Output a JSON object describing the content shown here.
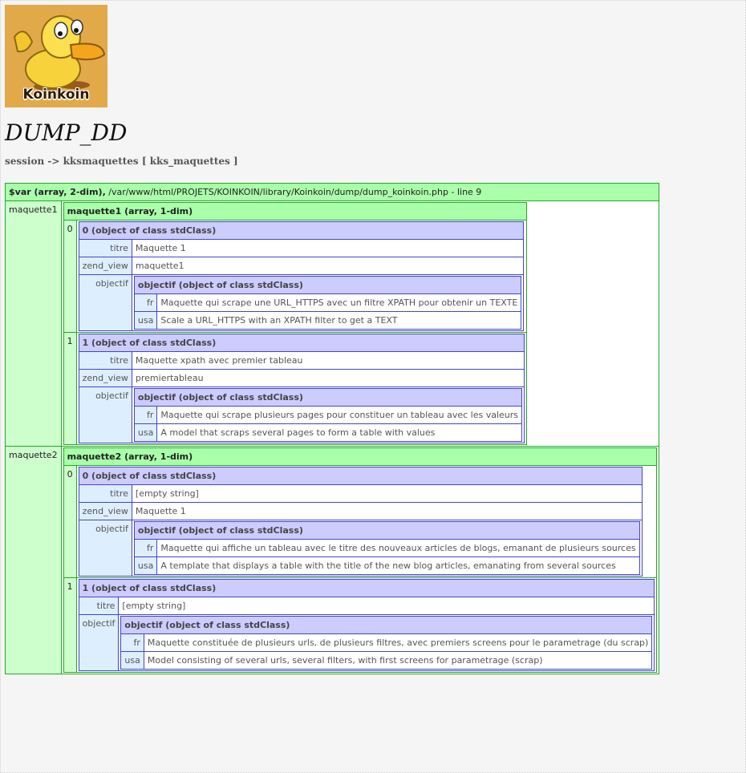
{
  "logo": {
    "text": "Koinkoin",
    "icon": "duck-mascot-icon"
  },
  "title": "DUMP_DD",
  "breadcrumb": "session -> kksmaquettes [ kks_maquettes ]",
  "dump": {
    "var_name": "$var (array, 2-dim),",
    "location": " /var/www/html/PROJETS/KOINKOIN/library/Koinkoin/dump/dump_koinkoin.php - line 9",
    "maquette1": {
      "key": "maquette1",
      "header": "maquette1 (array, 1-dim)",
      "items": [
        {
          "index": "0",
          "header": "0 (object of class stdClass)",
          "titre_key": "titre",
          "titre": "Maquette 1",
          "zend_key": "zend_view",
          "zend_view": "maquette1",
          "objectif_key": "objectif",
          "objectif_header": "objectif (object of class stdClass)",
          "fr_key": "fr",
          "fr": "Maquette qui scrape une URL_HTTPS avec un filtre XPATH pour obtenir un TEXTE",
          "usa_key": "usa",
          "usa": "Scale a URL_HTTPS with an XPATH filter to get a TEXT"
        },
        {
          "index": "1",
          "header": "1 (object of class stdClass)",
          "titre_key": "titre",
          "titre": "Maquette xpath avec premier tableau",
          "zend_key": "zend_view",
          "zend_view": "premiertableau",
          "objectif_key": "objectif",
          "objectif_header": "objectif (object of class stdClass)",
          "fr_key": "fr",
          "fr": "Maquette qui scrape plusieurs pages pour constituer un tableau avec les valeurs",
          "usa_key": "usa",
          "usa": "A model that scraps several pages to form a table with values"
        }
      ]
    },
    "maquette2": {
      "key": "maquette2",
      "header": "maquette2 (array, 1-dim)",
      "items": [
        {
          "index": "0",
          "header": "0 (object of class stdClass)",
          "titre_key": "titre",
          "titre": "[empty string]",
          "zend_key": "zend_view",
          "zend_view": "Maquette 1",
          "objectif_key": "objectif",
          "objectif_header": "objectif (object of class stdClass)",
          "fr_key": "fr",
          "fr": "Maquette qui affiche un tableau avec le titre des nouveaux articles de blogs, emanant de plusieurs sources",
          "usa_key": "usa",
          "usa": "A template that displays a table with the title of the new blog articles, emanating from several sources"
        },
        {
          "index": "1",
          "header": "1 (object of class stdClass)",
          "titre_key": "titre",
          "titre": "[empty string]",
          "objectif_key": "objectif",
          "objectif_header": "objectif (object of class stdClass)",
          "fr_key": "fr",
          "fr": "Maquette constituée de plusieurs urls, de plusieurs filtres, avec premiers screens pour le parametrage (du scrap)",
          "usa_key": "usa",
          "usa": "Model consisting of several urls, several filters, with first screens for parametrage (scrap)"
        }
      ]
    }
  },
  "colors": {
    "array_border": "#22aa22",
    "array_header": "#aaffaa",
    "array_key": "#ccffcc",
    "object_border": "#4444cc",
    "object_header": "#ccccff",
    "object_key": "#ddeeff",
    "logo_background": "#e2a94a"
  }
}
